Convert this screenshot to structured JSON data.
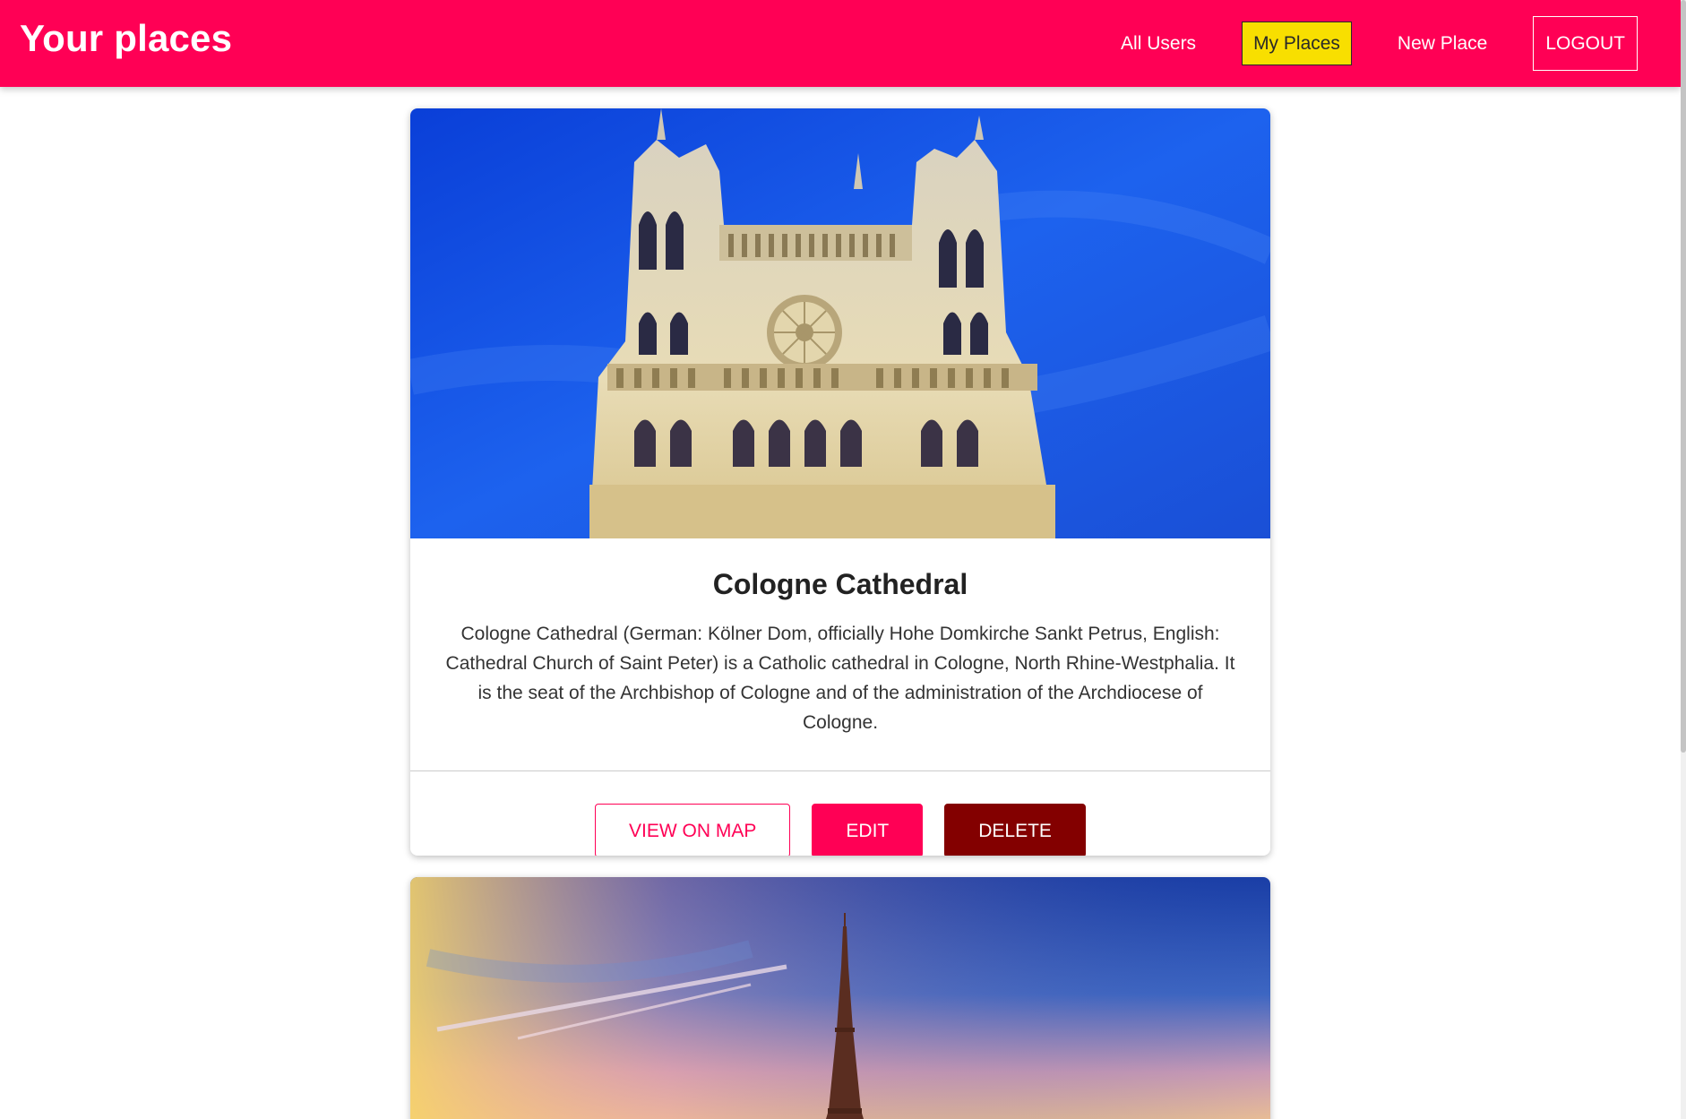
{
  "header": {
    "brand": "Your places",
    "nav": {
      "all_users": "All Users",
      "my_places": "My Places",
      "new_place": "New Place",
      "logout": "LOGOUT"
    }
  },
  "places": [
    {
      "title": "Cologne Cathedral",
      "description": "Cologne Cathedral (German: Kölner Dom, officially Hohe Domkirche Sankt Petrus, English: Cathedral Church of Saint Peter) is a Catholic cathedral in Cologne, North Rhine-Westphalia. It is the seat of the Archbishop of Cologne and of the administration of the Archdiocese of Cologne.",
      "actions": {
        "view": "VIEW ON MAP",
        "edit": "EDIT",
        "delete": "DELETE"
      }
    }
  ],
  "colors": {
    "header_bg": "#ff0055",
    "active_nav_bg": "#f8df00",
    "primary": "#ff0055",
    "danger": "#830000"
  }
}
